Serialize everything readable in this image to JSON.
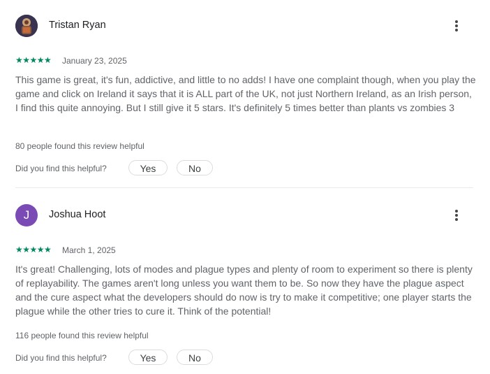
{
  "colors": {
    "star": "#01875f",
    "text": "#5f6368",
    "name": "#202124",
    "avatar_letter_bg": "#7b4bb5"
  },
  "reviews": [
    {
      "author": "Tristan Ryan",
      "avatar": {
        "type": "image",
        "letter": ""
      },
      "rating": 5,
      "stars": "★★★★★",
      "date": "January 23, 2025",
      "text": "This game is great, it's fun, addictive, and little to no adds! I have one complaint though, when you play the game and click on Ireland it says that it is ALL part of the UK, not just Northern Ireland, as an Irish person, I find this quite annoying. But I still give it 5 stars. It's definitely 5 times better than plants vs zombies 3",
      "helpful_count": "80 people found this review helpful",
      "helpful_question": "Did you find this helpful?",
      "yes_label": "Yes",
      "no_label": "No",
      "menu_icon": "more-vert-icon"
    },
    {
      "author": "Joshua Hoot",
      "avatar": {
        "type": "letter",
        "letter": "J"
      },
      "rating": 5,
      "stars": "★★★★★",
      "date": "March 1, 2025",
      "text": "It's great! Challenging, lots of modes and plague types and plenty of room to experiment so there is plenty of replayability. The games aren't long unless you want them to be. So now they have the plague aspect and the cure aspect what the developers should do now is try to make it competitive; one player starts the plague while the other tries to cure it. Think of the potential!",
      "helpful_count": "116 people found this review helpful",
      "helpful_question": "Did you find this helpful?",
      "yes_label": "Yes",
      "no_label": "No",
      "menu_icon": "more-vert-icon"
    }
  ]
}
